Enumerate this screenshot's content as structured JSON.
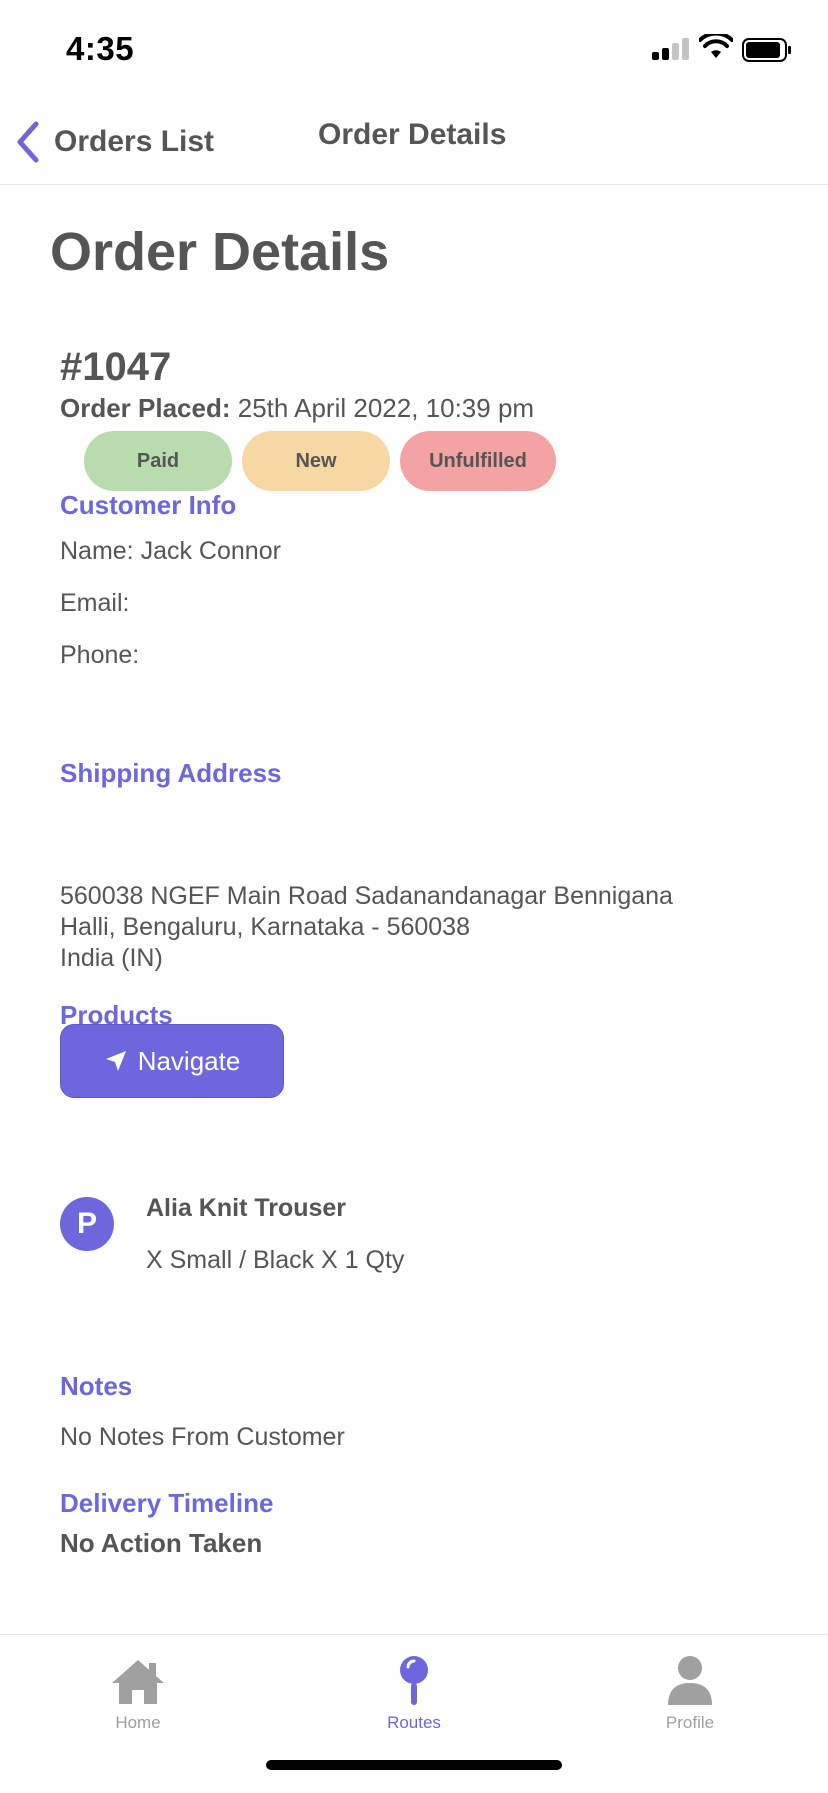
{
  "status_bar": {
    "time": "4:35",
    "icons": [
      "signal-icon",
      "wifi-icon",
      "battery-icon"
    ]
  },
  "nav_bar": {
    "back_label": "Orders List",
    "title": "Order Details",
    "back_icon": "chevron-left-icon"
  },
  "page": {
    "title": "Order Details"
  },
  "order": {
    "number": "#1047",
    "placed_label": "Order Placed:",
    "placed_value": " 25th April 2022, 10:39 pm",
    "badges": [
      {
        "label": "Paid",
        "color": "#b9dcae"
      },
      {
        "label": "New",
        "color": "#f7d8a2"
      },
      {
        "label": "Unfulfilled",
        "color": "#f3a4a2"
      }
    ]
  },
  "customer": {
    "heading": "Customer Info",
    "name": "Name: Jack Connor",
    "email": "Email:",
    "phone": "Phone:"
  },
  "shipping": {
    "heading": "Shipping Address",
    "address": " 560038 NGEF Main Road Sadanandanagar Bennigana\nHalli, Bengaluru, Karnataka - 560038\n India (IN)",
    "navigate_label": "Navigate",
    "navigate_icon": "location-arrow-icon"
  },
  "products": {
    "heading": "Products",
    "items": [
      {
        "avatar_letter": "P",
        "name": "Alia Knit Trouser",
        "variant": "X Small / Black X 1 Qty"
      }
    ]
  },
  "notes": {
    "heading": "Notes",
    "text": "No Notes From Customer"
  },
  "timeline": {
    "heading": "Delivery Timeline",
    "status": "No Action Taken"
  },
  "tab_bar": {
    "tabs": [
      {
        "label": "Home",
        "icon": "home-icon",
        "active": false
      },
      {
        "label": "Routes",
        "icon": "map-pin-icon",
        "active": true
      },
      {
        "label": "Profile",
        "icon": "user-icon",
        "active": false
      }
    ]
  },
  "colors": {
    "accent": "#6e66dc",
    "text": "#555555",
    "inactive_tab": "#a0a0a0"
  }
}
